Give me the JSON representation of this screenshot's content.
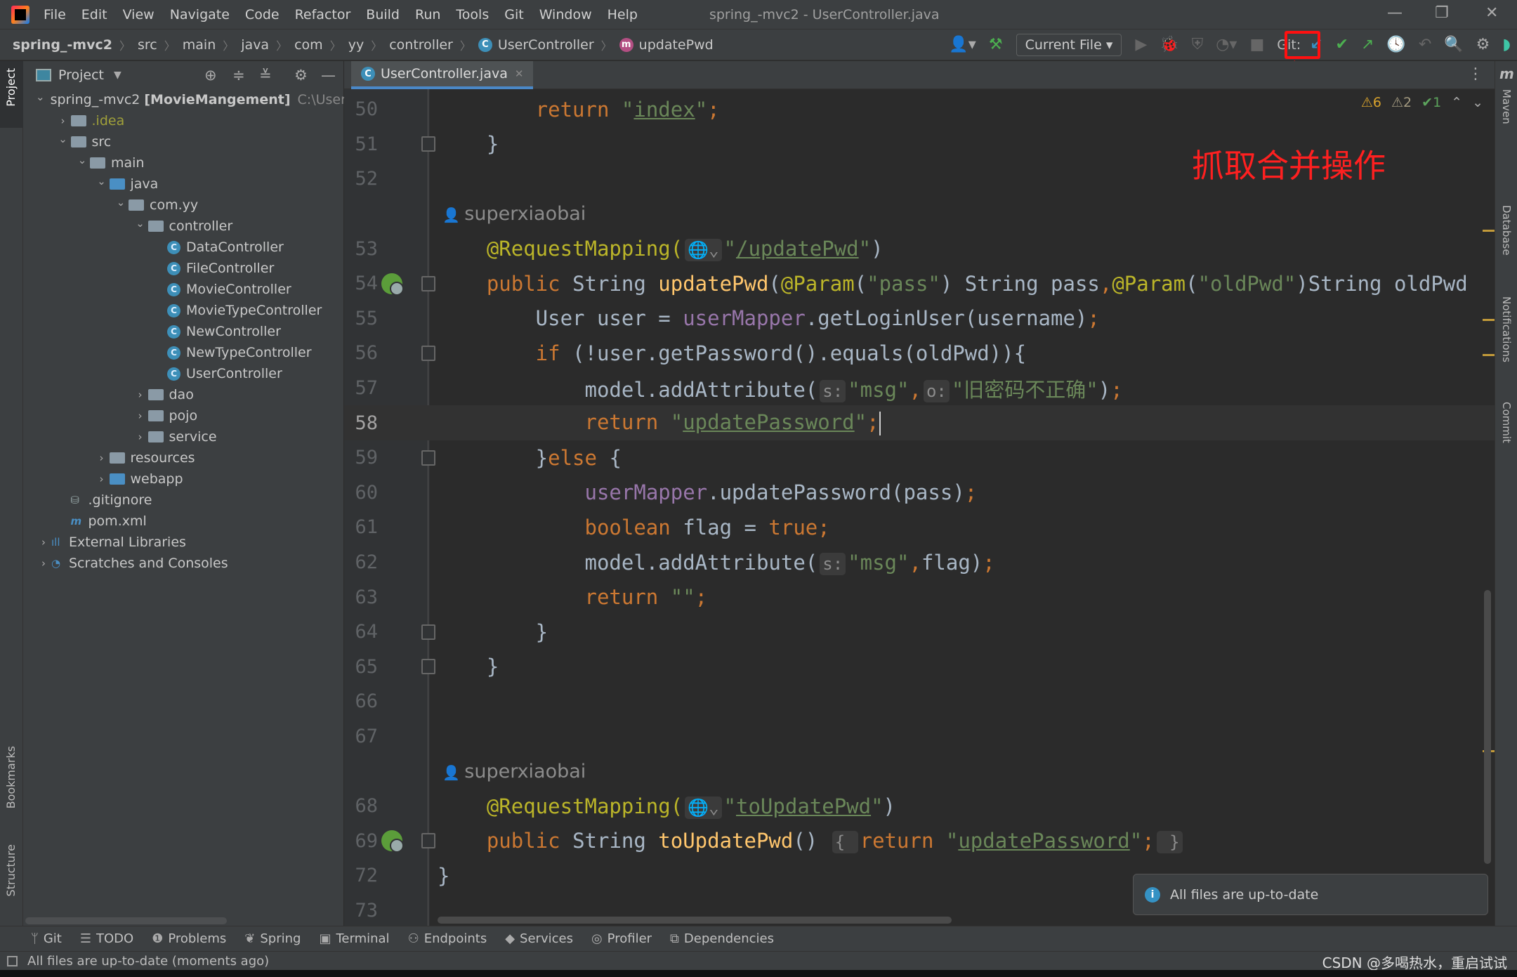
{
  "menu": {
    "items": [
      "File",
      "Edit",
      "View",
      "Navigate",
      "Code",
      "Refactor",
      "Build",
      "Run",
      "Tools",
      "Git",
      "Window",
      "Help"
    ],
    "title": "spring_-mvc2 - UserController.java"
  },
  "breadcrumb": {
    "items": [
      "spring_-mvc2",
      "src",
      "main",
      "java",
      "com",
      "yy",
      "controller",
      "UserController",
      "updatePwd"
    ]
  },
  "toolbar": {
    "run_config": "Current File",
    "git_label": "Git:",
    "icons": [
      "user-icon",
      "build-hammer-icon",
      "run-icon",
      "debug-icon",
      "coverage-icon",
      "profile-icon",
      "stop-icon",
      "git-update-icon",
      "git-commit-icon",
      "git-push-icon",
      "history-icon",
      "rollback-icon",
      "search-icon",
      "settings-icon",
      "jetbrains-logo-icon"
    ]
  },
  "project_panel": {
    "title": "Project",
    "tree": [
      {
        "depth": 0,
        "label": "spring_-mvc2",
        "bold": "[MovieMangement]",
        "extra": "C:\\Users\\",
        "type": "module",
        "open": true
      },
      {
        "depth": 1,
        "label": ".idea",
        "type": "folder",
        "open": false,
        "olive": true
      },
      {
        "depth": 1,
        "label": "src",
        "type": "folder",
        "open": true
      },
      {
        "depth": 2,
        "label": "main",
        "type": "folder",
        "open": true
      },
      {
        "depth": 3,
        "label": "java",
        "type": "folder-blue",
        "open": true
      },
      {
        "depth": 4,
        "label": "com.yy",
        "type": "folder",
        "open": true
      },
      {
        "depth": 5,
        "label": "controller",
        "type": "folder",
        "open": true
      },
      {
        "depth": 6,
        "label": "DataController",
        "type": "class"
      },
      {
        "depth": 6,
        "label": "FileController",
        "type": "class"
      },
      {
        "depth": 6,
        "label": "MovieController",
        "type": "class"
      },
      {
        "depth": 6,
        "label": "MovieTypeController",
        "type": "class"
      },
      {
        "depth": 6,
        "label": "NewController",
        "type": "class"
      },
      {
        "depth": 6,
        "label": "NewTypeController",
        "type": "class"
      },
      {
        "depth": 6,
        "label": "UserController",
        "type": "class"
      },
      {
        "depth": 5,
        "label": "dao",
        "type": "folder",
        "open": false
      },
      {
        "depth": 5,
        "label": "pojo",
        "type": "folder",
        "open": false
      },
      {
        "depth": 5,
        "label": "service",
        "type": "folder",
        "open": false
      },
      {
        "depth": 3,
        "label": "resources",
        "type": "folder",
        "open": false
      },
      {
        "depth": 3,
        "label": "webapp",
        "type": "folder-blue",
        "open": false
      },
      {
        "depth": 1,
        "label": ".gitignore",
        "type": "file"
      },
      {
        "depth": 1,
        "label": "pom.xml",
        "type": "maven"
      },
      {
        "depth": 0,
        "label": "External Libraries",
        "type": "lib",
        "open": false
      },
      {
        "depth": 0,
        "label": "Scratches and Consoles",
        "type": "scratch",
        "open": false
      }
    ]
  },
  "left_stripe": {
    "project": "Project",
    "bookmarks": "Bookmarks",
    "structure": "Structure"
  },
  "right_stripe": {
    "maven": "Maven",
    "database": "Database",
    "notifications": "Notifications",
    "commit": "Commit"
  },
  "editor": {
    "tab": "UserController.java",
    "inspections": {
      "warnings": "6",
      "weak_warnings": "2",
      "ok": "1"
    },
    "current_line": "58",
    "lines": [
      {
        "n": "50",
        "t": [
          [
            "        return ",
            "kw"
          ],
          [
            "\"",
            "str"
          ],
          [
            "index",
            "strl"
          ],
          [
            "\"",
            "str"
          ],
          [
            ";",
            "kw"
          ]
        ]
      },
      {
        "n": "51",
        "t": [
          [
            "    }",
            "pl"
          ]
        ],
        "fold": true
      },
      {
        "n": "52",
        "t": []
      },
      {
        "author": "superxiaobai"
      },
      {
        "n": "53",
        "t": [
          [
            "    @RequestMapping(",
            "ann"
          ],
          [
            "🌐⌄",
            "hint"
          ],
          [
            "\"",
            "str"
          ],
          [
            "/updatePwd",
            "strl"
          ],
          [
            "\"",
            "str"
          ],
          [
            ")",
            "pl"
          ]
        ]
      },
      {
        "n": "54",
        "gi": true,
        "fold": true,
        "t": [
          [
            "    public ",
            "kw"
          ],
          [
            "String ",
            "pl"
          ],
          [
            "updatePwd",
            "fn"
          ],
          [
            "(",
            "pl"
          ],
          [
            "@Param",
            "ann"
          ],
          [
            "(",
            "pl"
          ],
          [
            "\"pass\"",
            "str"
          ],
          [
            ") String pass",
            "pl"
          ],
          [
            ",",
            "kw"
          ],
          [
            "@Param",
            "ann"
          ],
          [
            "(",
            "pl"
          ],
          [
            "\"oldPwd\"",
            "str"
          ],
          [
            ")String oldPwd",
            "pl"
          ]
        ]
      },
      {
        "n": "55",
        "t": [
          [
            "        User user = ",
            "pl"
          ],
          [
            "userMapper",
            "fld"
          ],
          [
            ".getLoginUser(username)",
            "pl"
          ],
          [
            ";",
            "kw"
          ]
        ]
      },
      {
        "n": "56",
        "fold": true,
        "t": [
          [
            "        if ",
            "kw"
          ],
          [
            "(!user.getPassword().equals(oldPwd)){",
            "pl"
          ]
        ]
      },
      {
        "n": "57",
        "t": [
          [
            "            model.addAttribute(",
            "pl"
          ],
          [
            "s:",
            "hint"
          ],
          [
            "\"msg\"",
            "str"
          ],
          [
            ",",
            "kw"
          ],
          [
            "o:",
            "hint"
          ],
          [
            "\"旧密码不正确\"",
            "str"
          ],
          [
            ")",
            "pl"
          ],
          [
            ";",
            "kw"
          ]
        ]
      },
      {
        "n": "58",
        "cur": true,
        "t": [
          [
            "            return ",
            "kw"
          ],
          [
            "\"",
            "str"
          ],
          [
            "updatePassword",
            "strl"
          ],
          [
            "\"",
            "str"
          ],
          [
            ";",
            "kw"
          ]
        ]
      },
      {
        "n": "59",
        "fold": true,
        "t": [
          [
            "        }",
            "pl"
          ],
          [
            "else ",
            "kw"
          ],
          [
            "{",
            "pl"
          ]
        ]
      },
      {
        "n": "60",
        "t": [
          [
            "            ",
            "pl"
          ],
          [
            "userMapper",
            "fld"
          ],
          [
            ".updatePassword(pass)",
            "pl"
          ],
          [
            ";",
            "kw"
          ]
        ]
      },
      {
        "n": "61",
        "t": [
          [
            "            boolean ",
            "kw"
          ],
          [
            "flag = ",
            "pl"
          ],
          [
            "true",
            "kw"
          ],
          [
            ";",
            "kw"
          ]
        ]
      },
      {
        "n": "62",
        "t": [
          [
            "            model.addAttribute(",
            "pl"
          ],
          [
            "s:",
            "hint"
          ],
          [
            "\"msg\"",
            "str"
          ],
          [
            ",",
            "kw"
          ],
          [
            "flag)",
            "pl"
          ],
          [
            ";",
            "kw"
          ]
        ]
      },
      {
        "n": "63",
        "t": [
          [
            "            return ",
            "kw"
          ],
          [
            "\"\"",
            "str"
          ],
          [
            ";",
            "kw"
          ]
        ]
      },
      {
        "n": "64",
        "fold": true,
        "t": [
          [
            "        }",
            "pl"
          ]
        ]
      },
      {
        "n": "65",
        "fold": true,
        "t": [
          [
            "    }",
            "pl"
          ]
        ]
      },
      {
        "n": "66",
        "t": []
      },
      {
        "n": "67",
        "t": []
      },
      {
        "author": "superxiaobai"
      },
      {
        "n": "68",
        "t": [
          [
            "    @RequestMapping(",
            "ann"
          ],
          [
            "🌐⌄",
            "hint"
          ],
          [
            "\"",
            "str"
          ],
          [
            "toUpdatePwd",
            "strl"
          ],
          [
            "\"",
            "str"
          ],
          [
            ")",
            "pl"
          ]
        ]
      },
      {
        "n": "69",
        "gi": true,
        "fold": true,
        "t": [
          [
            "    public ",
            "kw"
          ],
          [
            "String ",
            "pl"
          ],
          [
            "toUpdatePwd",
            "fn"
          ],
          [
            "() ",
            "pl"
          ],
          [
            "{ ",
            "hint"
          ],
          [
            "return ",
            "kw"
          ],
          [
            "\"",
            "str"
          ],
          [
            "updatePassword",
            "strl"
          ],
          [
            "\"",
            "str"
          ],
          [
            ";",
            "kw"
          ],
          [
            " }",
            "hint"
          ]
        ]
      },
      {
        "n": "72",
        "t": [
          [
            "}",
            "pl"
          ]
        ]
      },
      {
        "n": "73",
        "t": []
      }
    ]
  },
  "annotation": "抓取合并操作",
  "notification": "All files are up-to-date",
  "bottom_tools": [
    "Git",
    "TODO",
    "Problems",
    "Spring",
    "Terminal",
    "Endpoints",
    "Services",
    "Profiler",
    "Dependencies"
  ],
  "status": {
    "message": "All files are up-to-date (moments ago)",
    "watermark": "CSDN @多喝热水，重启试试"
  },
  "colors": {
    "keyword": "#cc7832",
    "string": "#6a8759",
    "method": "#ffc66d",
    "annotation": "#bbb529",
    "field": "#9876aa",
    "highlight": "#ff1010"
  }
}
